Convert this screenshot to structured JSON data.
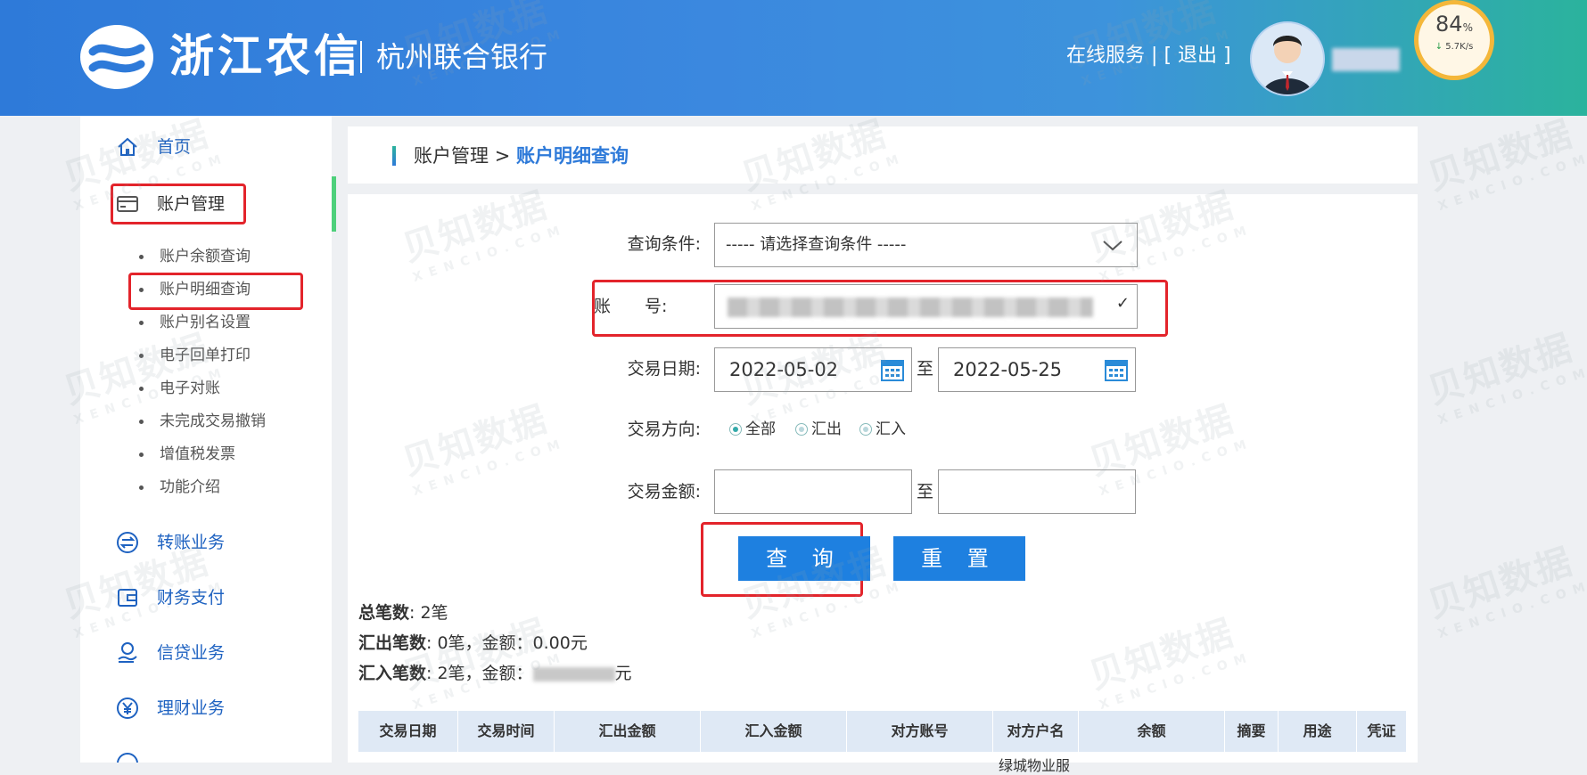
{
  "header": {
    "logo_text": "浙江农信",
    "bank_name": "杭州联合银行",
    "online_service": "在线服务",
    "separator": "|",
    "logout": "[ 退出 ]",
    "gauge_percent": "84",
    "gauge_percent_unit": "%",
    "gauge_speed": "5.7K/s"
  },
  "sidebar": {
    "home": "首页",
    "account_mgmt": "账户管理",
    "sub_items": [
      "账户余额查询",
      "账户明细查询",
      "账户别名设置",
      "电子回单打印",
      "电子对账",
      "未完成交易撤销",
      "增值税发票",
      "功能介绍"
    ],
    "transfer": "转账业务",
    "finance_pay": "财务支付",
    "credit": "信贷业务",
    "wealth": "理财业务"
  },
  "breadcrumb": {
    "parent": "账户管理",
    "sep": ">",
    "current": "账户明细查询"
  },
  "form": {
    "condition_label": "查询条件:",
    "condition_value": "----- 请选择查询条件 -----",
    "account_label": "账　　号:",
    "date_label": "交易日期:",
    "date_from": "2022-05-02",
    "date_to": "2022-05-25",
    "to_text": "至",
    "direction_label": "交易方向:",
    "direction_all": "全部",
    "direction_out": "汇出",
    "direction_in": "汇入",
    "amount_label": "交易金额:",
    "query_button": "查 询",
    "reset_button": "重 置"
  },
  "summary": {
    "total_label": "总笔数",
    "total_value": ": 2笔",
    "out_label": "汇出笔数",
    "out_value": ": 0笔，金额：0.00元",
    "in_label": "汇入笔数",
    "in_value": ": 2笔，金额：",
    "in_unit": "元"
  },
  "table": {
    "headers": [
      "交易日期",
      "交易时间",
      "汇出金额",
      "汇入金额",
      "对方账号",
      "对方户名",
      "余额",
      "摘要",
      "用途",
      "凭证"
    ],
    "row_peek": "绿城物业服"
  },
  "watermark": {
    "text": "贝知数据",
    "sub": "XENCIO.COM"
  },
  "colors": {
    "header_start": "#2e7ad9",
    "header_end": "#2bb39d",
    "nav_blue": "#1e62c1",
    "button_blue": "#1e80e0",
    "highlight_red": "#e3242b",
    "active_bar": "#4ed07b"
  }
}
